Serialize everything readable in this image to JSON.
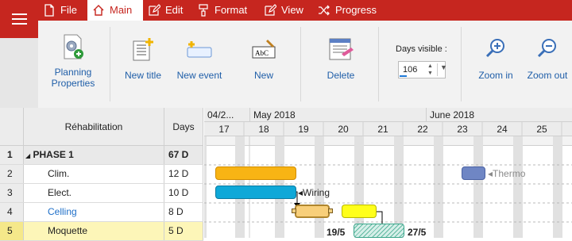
{
  "menu": {
    "items": [
      {
        "label": "File",
        "icon": "file-icon"
      },
      {
        "label": "Main",
        "icon": "home-icon",
        "active": true
      },
      {
        "label": "Edit",
        "icon": "edit-icon"
      },
      {
        "label": "Format",
        "icon": "format-paint-icon"
      },
      {
        "label": "View",
        "icon": "view-icon"
      },
      {
        "label": "Progress",
        "icon": "shuffle-icon"
      }
    ]
  },
  "ribbon": {
    "planning_properties": "Planning\nProperties",
    "new_title": "New title",
    "new_event": "New event",
    "new": "New",
    "delete": "Delete",
    "days_visible_label": "Days visible :",
    "days_visible_value": "106",
    "zoom_in": "Zoom in",
    "zoom_out": "Zoom out"
  },
  "grid": {
    "header_name": "Réhabilitation",
    "header_days": "Days",
    "rows": [
      {
        "num": "1",
        "name": "PHASE 1",
        "days": "67 D"
      },
      {
        "num": "2",
        "name": "Clim.",
        "days": "12 D"
      },
      {
        "num": "3",
        "name": "Elect.",
        "days": "10 D"
      },
      {
        "num": "4",
        "name": "Celling",
        "days": "8 D"
      },
      {
        "num": "5",
        "name": "Moquette",
        "days": "5 D"
      }
    ]
  },
  "gantt": {
    "months": [
      "04/2...",
      "May 2018",
      "June 2018"
    ],
    "days": [
      "17",
      "18",
      "19",
      "20",
      "21",
      "22",
      "23",
      "24",
      "25"
    ],
    "labels": {
      "thermo": "Thermo",
      "wiring": "Wiring",
      "date_start": "19/5",
      "date_end": "27/5"
    },
    "colors": {
      "clim": "#f8b414",
      "thermo": "#6f86c4",
      "elect": "#0fa8d8",
      "celling": "#f8cf7a",
      "yellow": "#ffff1a",
      "accent": "#c6261f"
    }
  }
}
